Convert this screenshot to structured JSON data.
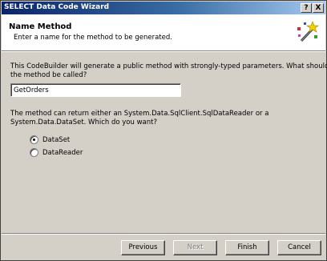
{
  "window": {
    "title": "SELECT Data Code Wizard"
  },
  "titlebar_buttons": {
    "help": "?",
    "close": "X"
  },
  "header": {
    "title": "Name Method",
    "subtitle": "Enter a name for the method to be generated."
  },
  "body": {
    "intro_line1": "This CodeBuilder will generate a public method with strongly-typed parameters.  What should",
    "intro_line2": "the method be called?",
    "method_name_value": "GetOrders",
    "return_line1": "The method can return either an System.Data.SqlClient.SqlDataReader or a",
    "return_line2": "System.Data.DataSet.  Which do you want?",
    "options": [
      {
        "label": "DataSet",
        "selected": true
      },
      {
        "label": "DataReader",
        "selected": false
      }
    ]
  },
  "buttons": {
    "previous": "Previous",
    "next": "Next",
    "finish": "Finish",
    "cancel": "Cancel"
  },
  "icons": {
    "header_icon": "magic-wand-icon"
  }
}
